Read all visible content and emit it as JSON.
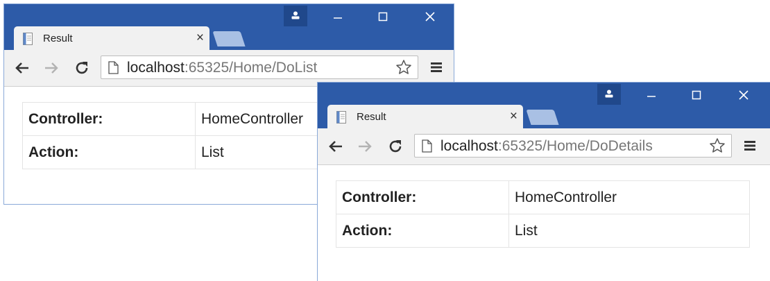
{
  "windows": [
    {
      "tab_title": "Result",
      "tab_close": "×",
      "url_host": "localhost",
      "url_rest": ":65325/Home/DoList",
      "rows": [
        {
          "label": "Controller:",
          "value": "HomeController"
        },
        {
          "label": "Action:",
          "value": "List"
        }
      ]
    },
    {
      "tab_title": "Result",
      "tab_close": "×",
      "url_host": "localhost",
      "url_rest": ":65325/Home/DoDetails",
      "rows": [
        {
          "label": "Controller:",
          "value": "HomeController"
        },
        {
          "label": "Action:",
          "value": "List"
        }
      ]
    }
  ],
  "icons": {
    "back": "arrow-left-icon",
    "forward": "arrow-right-icon",
    "reload": "reload-icon",
    "page": "page-icon",
    "bookmark": "star-icon",
    "menu": "hamburger-menu-icon",
    "profile": "profile-icon",
    "minimize": "minimize-icon",
    "maximize": "maximize-icon",
    "close": "close-icon"
  },
  "colors": {
    "titlebar": "#2d5ba8",
    "toolbar": "#f1f1f1",
    "new_tab": "#a9c0e4",
    "profile_button": "#20488b"
  }
}
